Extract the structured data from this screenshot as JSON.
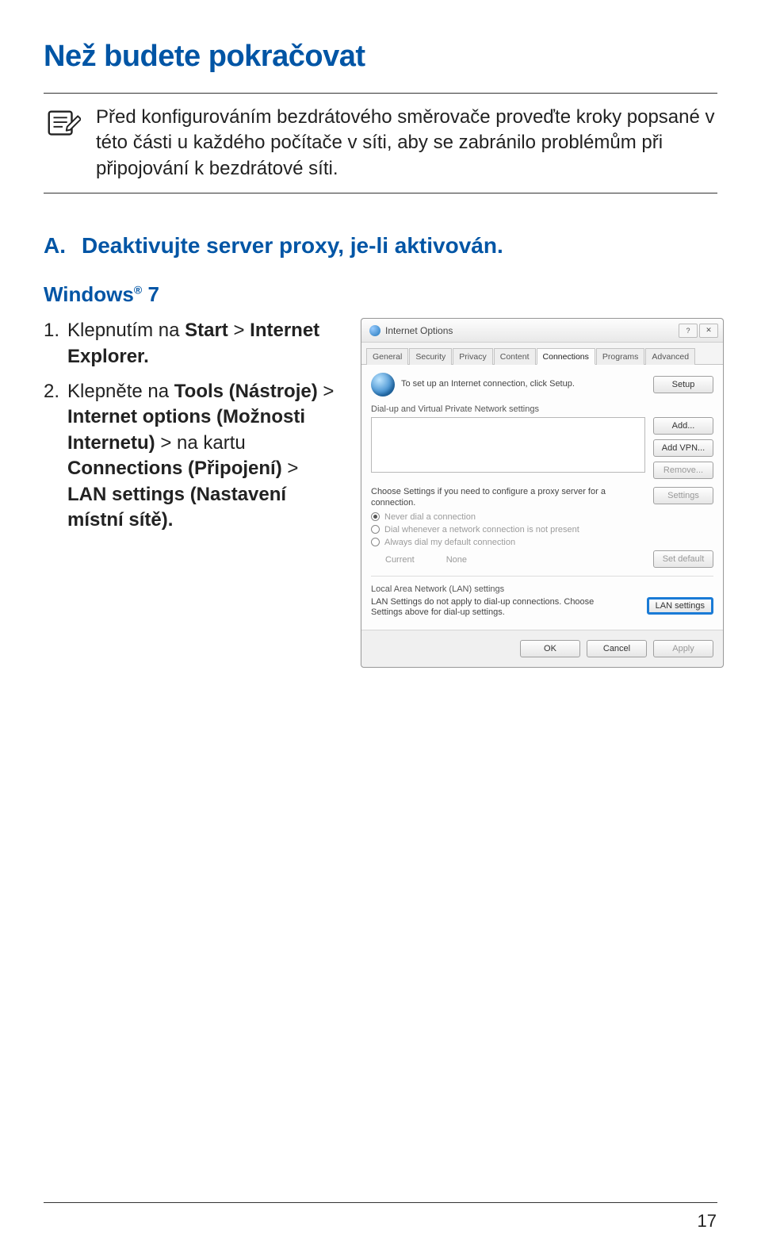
{
  "page": {
    "title": "Než budete pokračovat",
    "note": "Před konfigurováním bezdrátového směrovače proveďte kroky popsané v této části u každého počítače v síti, aby se zabránilo problémům při připojování k bezdrátové síti.",
    "section_letter": "A.",
    "section_title": "Deaktivujte server proxy, je-li aktivován.",
    "os": "Windows",
    "os_suffix": "7",
    "steps": [
      {
        "num": "1.",
        "pre": "Klepnutím na ",
        "b1": "Start",
        "mid": " > ",
        "b2": "Internet Explorer.",
        "post": ""
      },
      {
        "num": "2.",
        "pre": "Klepněte na ",
        "b1": "Tools (Nástroje)",
        "mid": " > ",
        "b2": "Internet options (Možnosti Internetu)",
        "post1": " > na kartu ",
        "b3": "Connections (Připojení)",
        "post2": " > ",
        "b4": "LAN settings (Nastavení místní sítě).",
        "post3": ""
      }
    ],
    "page_number": "17"
  },
  "dialog": {
    "title": "Internet Options",
    "tabs": [
      "General",
      "Security",
      "Privacy",
      "Content",
      "Connections",
      "Programs",
      "Advanced"
    ],
    "setup_text": "To set up an Internet connection, click Setup.",
    "setup_btn": "Setup",
    "vpn_label": "Dial-up and Virtual Private Network settings",
    "add_btn": "Add...",
    "add_vpn_btn": "Add VPN...",
    "remove_btn": "Remove...",
    "proxy_text": "Choose Settings if you need to configure a proxy server for a connection.",
    "settings_btn": "Settings",
    "r1": "Never dial a connection",
    "r2": "Dial whenever a network connection is not present",
    "r3": "Always dial my default connection",
    "current_lbl": "Current",
    "current_val": "None",
    "set_default_btn": "Set default",
    "lan_label": "Local Area Network (LAN) settings",
    "lan_text": "LAN Settings do not apply to dial-up connections. Choose Settings above for dial-up settings.",
    "lan_btn": "LAN settings",
    "ok": "OK",
    "cancel": "Cancel",
    "apply": "Apply"
  }
}
